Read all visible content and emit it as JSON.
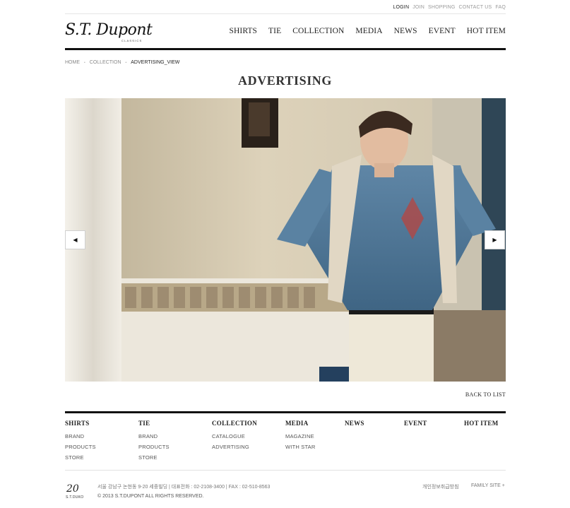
{
  "util_nav": {
    "login": "LOGIN",
    "join": "JOIN",
    "shopping": "SHOPPING",
    "contact": "CONTACT US",
    "faq": "FAQ"
  },
  "brand": {
    "logo": "S.T. Dupont",
    "logo_sub": "CLASSICS"
  },
  "gnb": [
    "SHIRTS",
    "TIE",
    "COLLECTION",
    "MEDIA",
    "NEWS",
    "EVENT",
    "HOT ITEM"
  ],
  "breadcrumb": {
    "home": "HOME",
    "collection": "COLLECTION",
    "current": "ADVERTISING_VIEW"
  },
  "page_title": "ADVERTISING",
  "slider": {
    "prev": "◀",
    "next": "▶"
  },
  "back_to_list": "BACK TO LIST",
  "footer_nav": [
    {
      "title": "SHIRTS",
      "items": [
        "BRAND",
        "PRODUCTS",
        "STORE"
      ]
    },
    {
      "title": "TIE",
      "items": [
        "BRAND",
        "PRODUCTS",
        "STORE"
      ]
    },
    {
      "title": "COLLECTION",
      "items": [
        "CATALOGUE",
        "ADVERTISING"
      ]
    },
    {
      "title": "MEDIA",
      "items": [
        "MAGAZINE",
        "WITH STAR"
      ]
    },
    {
      "title": "NEWS",
      "items": []
    },
    {
      "title": "EVENT",
      "items": []
    },
    {
      "title": "HOT ITEM",
      "items": []
    }
  ],
  "footer": {
    "logo": "20",
    "logo_sub": "S.T.DUKO",
    "address": "서울 강남구 논현동 9-20 세중빌딩  |  대표전화 : 02-2108-3400  |  FAX : 02-510-8563",
    "copyright": "© 2013 S.T.DUPONT ALL RIGHTS RESERVED.",
    "privacy": "개인정보취급방침",
    "family_site": "FAMILY SITE +"
  },
  "colors": {
    "accent": "#111111",
    "muted": "#9a9a9a"
  }
}
